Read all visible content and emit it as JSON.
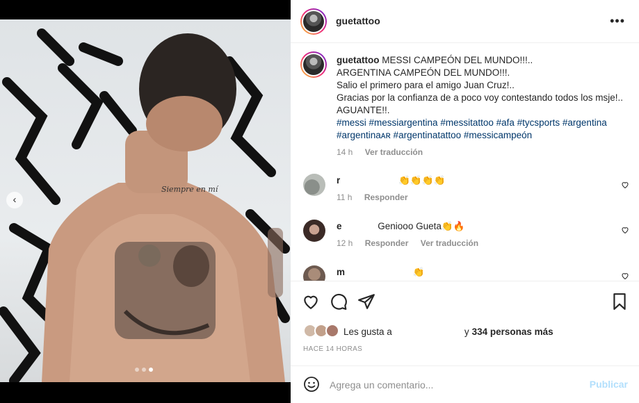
{
  "post": {
    "username": "guetattoo",
    "more_icon": "ellipsis-icon"
  },
  "caption": {
    "username": "guetattoo",
    "line1": "MESSI CAMPEÓN DEL MUNDO!!!..",
    "line2": "ARGENTINA CAMPEÓN DEL MUNDO!!!.",
    "line3": "Salio el primero para el amigo Juan Cruz!..",
    "line4": "Gracias por la confianza de a poco voy contestando todos los msje!.. AGUANTE!!.",
    "hashtags": "#messi #messiargentina #messitattoo #afa #tycsports #argentina #argentinaᴀʀ #argentinatattoo #messicampeón",
    "time": "14 h",
    "translate": "Ver traducción"
  },
  "comments": [
    {
      "user": "r",
      "text": "👏👏👏👏",
      "time": "11 h",
      "reply": "Responder",
      "translate": ""
    },
    {
      "user": "e",
      "text": "Geniooo Gueta👏🔥",
      "time": "12 h",
      "reply": "Responder",
      "translate": "Ver traducción"
    },
    {
      "user": "m",
      "text": "👏",
      "time": "",
      "reply": "",
      "translate": ""
    }
  ],
  "likes": {
    "prefix": "Les gusta a",
    "conjunction": "y",
    "count": "334 personas más"
  },
  "timestamp": "HACE 14 HORAS",
  "add_comment": {
    "placeholder": "Agrega un comentario...",
    "publish": "Publicar"
  },
  "carousel": {
    "total": 3,
    "active": 3
  },
  "colors": {
    "link": "#00376b",
    "publish": "#b2dffc",
    "muted": "#8e8e8e"
  }
}
